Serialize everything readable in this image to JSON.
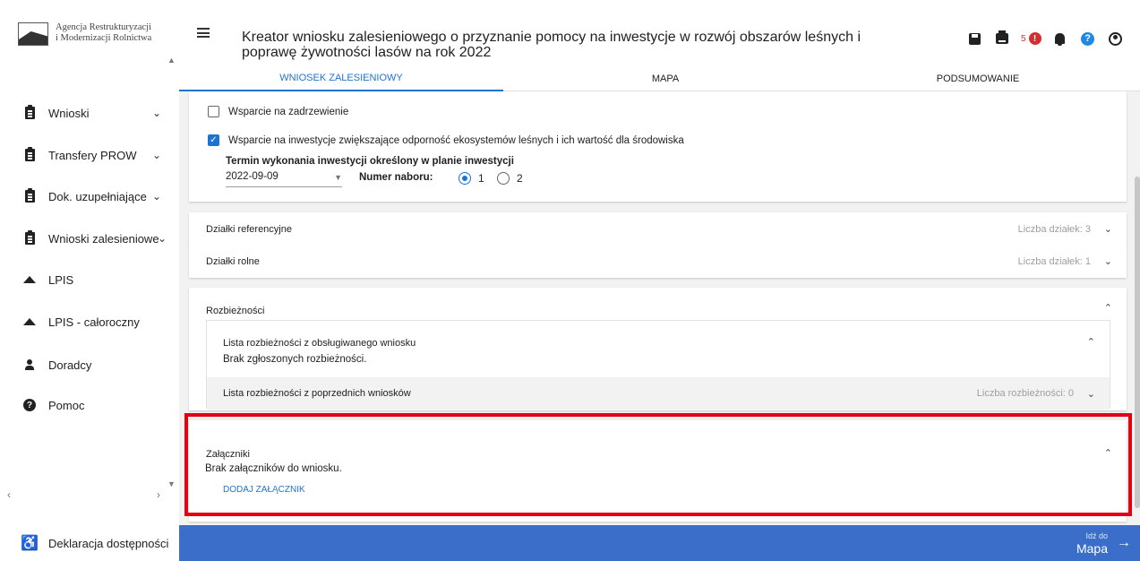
{
  "brand": {
    "line1": "Agencja Restrukturyzacji",
    "line2": "i Modernizacji Rolnictwa"
  },
  "sidebar": {
    "items": [
      {
        "label": "Wnioski",
        "icon": "clipboard-icon",
        "has_chevron": true
      },
      {
        "label": "Transfery PROW",
        "icon": "clipboard-icon",
        "has_chevron": true
      },
      {
        "label": "Dok. uzupełniające",
        "icon": "clipboard-icon",
        "has_chevron": true
      },
      {
        "label": "Wnioski zalesieniowe",
        "icon": "clipboard-icon",
        "has_chevron": true
      },
      {
        "label": "LPIS",
        "icon": "terrain-icon",
        "has_chevron": false
      },
      {
        "label": "LPIS - całoroczny",
        "icon": "terrain-icon",
        "has_chevron": false
      },
      {
        "label": "Doradcy",
        "icon": "person-icon",
        "has_chevron": false
      },
      {
        "label": "Pomoc",
        "icon": "help-icon",
        "has_chevron": false
      }
    ],
    "footer_label": "Deklaracja dostępności"
  },
  "header": {
    "title": "Kreator wniosku zalesieniowego o przyznanie pomocy na inwestycje w rozwój obszarów leśnych i poprawę żywotności lasów na rok 2022",
    "error_count": "5",
    "tabs": [
      {
        "label": "WNIOSEK ZALESIENIOWY",
        "active": true
      },
      {
        "label": "MAPA",
        "active": false
      },
      {
        "label": "PODSUMOWANIE",
        "active": false
      }
    ]
  },
  "support": {
    "option1_label": "Wsparcie na zadrzewienie",
    "option1_checked": false,
    "option2_label": "Wsparcie na inwestycje zwiększające odporność ekosystemów leśnych i ich wartość dla środowiska",
    "option2_checked": true,
    "term_label": "Termin wykonania inwestycji określony w planie inwestycji",
    "term_value": "2022-09-09",
    "nabor_label": "Numer naboru:",
    "nabor_options": [
      "1",
      "2"
    ],
    "nabor_selected": "1"
  },
  "dzialki_ref": {
    "title": "Działki referencyjne",
    "count": "Liczba działek: 3"
  },
  "dzialki_rolne": {
    "title": "Działki rolne",
    "count": "Liczba działek: 1"
  },
  "rozbieznosci": {
    "title": "Rozbieżności",
    "current_title": "Lista rozbieżności z obsługiwanego wniosku",
    "current_empty": "Brak zgłoszonych rozbieżności.",
    "previous_title": "Lista rozbieżności z poprzednich wniosków",
    "previous_count": "Liczba rozbieżności: 0"
  },
  "zalaczniki": {
    "title": "Załączniki",
    "empty": "Brak załączników do wniosku.",
    "add_label": "DODAJ ZAŁĄCZNIK"
  },
  "footer": {
    "next_small": "Idź do",
    "next_big": "Mapa"
  },
  "colors": {
    "accent": "#1e73d2",
    "footer_bar": "#3a6ec9",
    "highlight": "#e3000f",
    "error": "#d32f2f"
  }
}
